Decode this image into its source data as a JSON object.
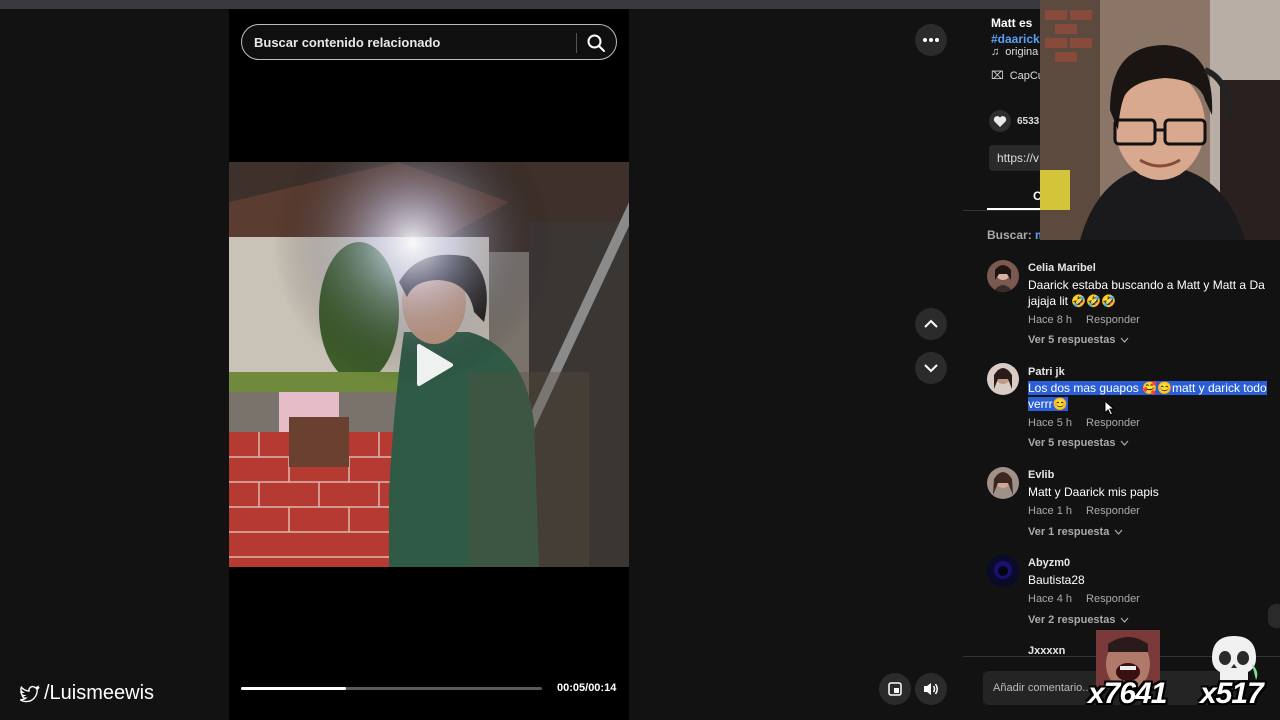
{
  "social": {
    "handle": "/Luismeewis"
  },
  "video": {
    "search_placeholder": "Buscar contenido relacionado",
    "time_display": "00:05/00:14",
    "progress": 0.35
  },
  "post": {
    "description": "Matt es",
    "hashtag": "#daarick",
    "music": "origina",
    "capcut": "CapCu",
    "likes": "6533",
    "link": "https://v",
    "tab_initial": "C",
    "search_label": "Buscar:",
    "search_term": "ma"
  },
  "comments": [
    {
      "user": "Celia Maribel",
      "text": "Daarick estaba buscando a Matt y Matt a Da jajaja lit 🤣🤣🤣",
      "time": "Hace 8 h",
      "reply": "Responder",
      "replies": "Ver 5 respuestas",
      "highlighted": false
    },
    {
      "user": "Patri jk",
      "text": "Los dos mas guapos 🥰😊matt y darick todo verrr😊",
      "time": "Hace 5 h",
      "reply": "Responder",
      "replies": "Ver 5 respuestas",
      "highlighted": true
    },
    {
      "user": "Evlib",
      "text": "Matt y Daarick mis papis",
      "time": "Hace 1 h",
      "reply": "Responder",
      "replies": "Ver 1 respuesta",
      "highlighted": false
    },
    {
      "user": "Abyzm0",
      "text": "Bautista28",
      "time": "Hace 4 h",
      "reply": "Responder",
      "replies": "Ver 2 respuestas",
      "highlighted": false
    },
    {
      "user": "Jxxxxn",
      "text": "",
      "time": "",
      "reply": "",
      "replies": "",
      "highlighted": false
    }
  ],
  "comment_input": {
    "placeholder": "Añadir comentario..."
  },
  "overlays": {
    "emote1_count": "x7641",
    "emote2_count": "x517"
  },
  "colors": {
    "accent_link": "#5aa0f5",
    "highlight": "#2a5fd6",
    "background": "#121212"
  }
}
